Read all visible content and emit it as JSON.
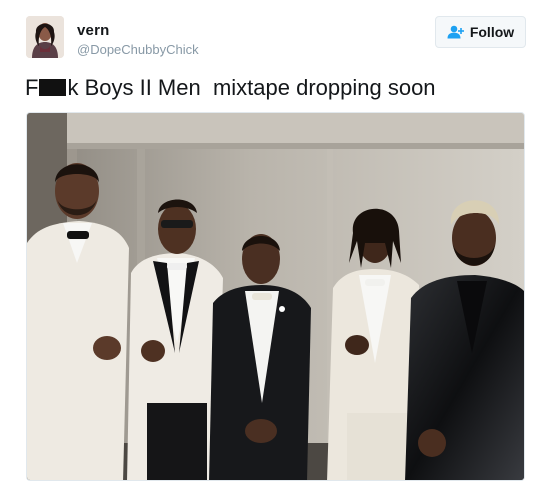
{
  "tweet": {
    "display_name": "vern",
    "handle": "@DopeChubbyChick",
    "follow_label": "Follow",
    "text_prefix": "F",
    "text_suffix": "k Boys II Men  mixtape dropping soon"
  },
  "icons": {
    "follow": "add-user-icon",
    "avatar": "profile-photo"
  },
  "colors": {
    "accent": "#1da1f2",
    "name": "#14171a",
    "handle": "#8899a6",
    "border": "#e1e8ed"
  }
}
